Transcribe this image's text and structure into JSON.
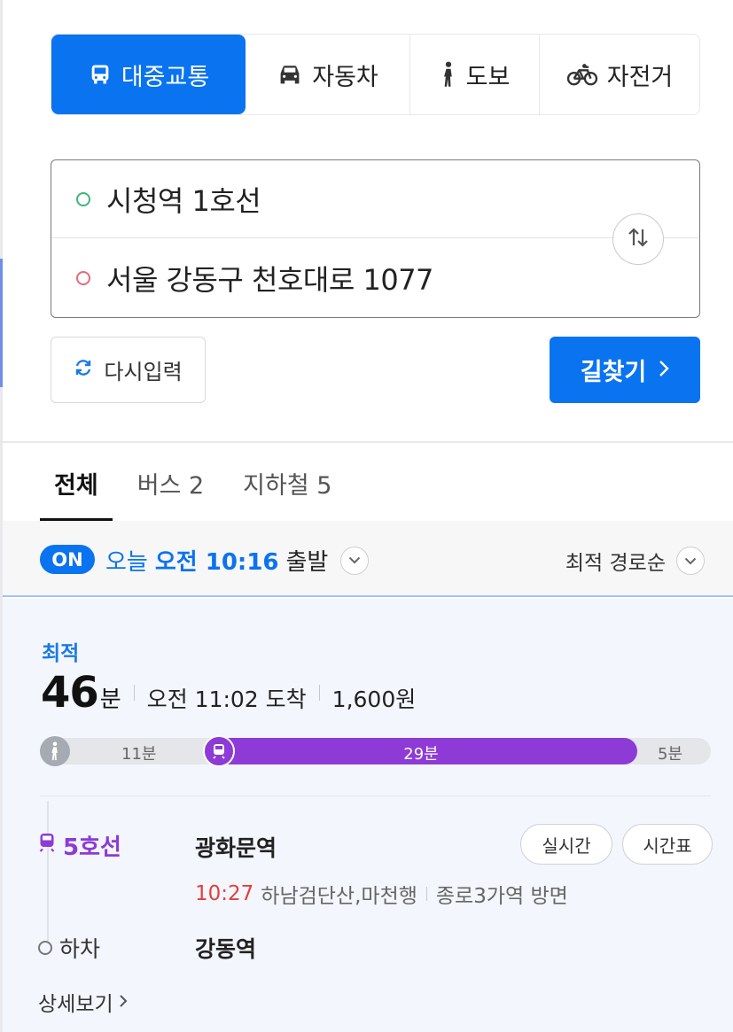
{
  "mode_tabs": [
    {
      "label": "대중교통",
      "icon": "bus-icon",
      "active": true
    },
    {
      "label": "자동차",
      "icon": "car-icon",
      "active": false
    },
    {
      "label": "도보",
      "icon": "walk-icon",
      "active": false
    },
    {
      "label": "자전거",
      "icon": "bicycle-icon",
      "active": false
    }
  ],
  "route": {
    "origin": "시청역 1호선",
    "destination": "서울 강동구 천호대로 1077"
  },
  "actions": {
    "reset_label": "다시입력",
    "search_label": "길찾기"
  },
  "result_tabs": [
    {
      "label": "전체",
      "active": true
    },
    {
      "label": "버스 2",
      "active": false
    },
    {
      "label": "지하철 5",
      "active": false
    }
  ],
  "depart": {
    "on_label": "ON",
    "day": "오늘",
    "time": "오전 10:16",
    "suffix": "출발",
    "sort_label": "최적 경로순"
  },
  "result": {
    "badge": "최적",
    "duration_num": "46",
    "duration_unit": "분",
    "arrival": "오전 11:02 도착",
    "fare": "1,600원",
    "timeline": {
      "walk_start": "11분",
      "subway": "29분",
      "walk_end": "5분"
    },
    "line": "5호선",
    "board_station": "광화문역",
    "realtime_label": "실시간",
    "timetable_label": "시간표",
    "next_time": "10:27",
    "direction_dest": "하남검단산,마천행",
    "direction_toward": "종로3가역 방면",
    "alight_label": "하차",
    "alight_station": "강동역",
    "detail_label": "상세보기"
  },
  "colors": {
    "brand_blue": "#0a73f0",
    "line5_purple": "#8d3ad6",
    "time_red": "#e2403c"
  }
}
